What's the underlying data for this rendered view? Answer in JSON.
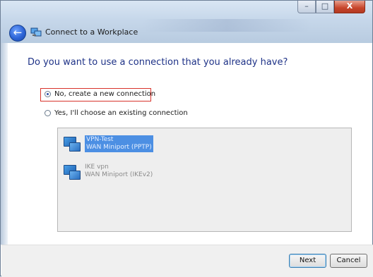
{
  "window": {
    "title": "Connect to a Workplace",
    "controls": {
      "minimize": "–",
      "maximize": "□",
      "close": "X"
    }
  },
  "page": {
    "question": "Do you want to use a connection that you already have?",
    "options": [
      {
        "label": "No, create a new connection",
        "selected": true
      },
      {
        "label": "Yes, I'll choose an existing connection",
        "selected": false
      }
    ]
  },
  "connections": [
    {
      "name": "VPN-Test",
      "device": "WAN Miniport (PPTP)",
      "selected": true
    },
    {
      "name": "IKE vpn",
      "device": "WAN Miniport (IKEv2)",
      "selected": false
    }
  ],
  "footer": {
    "next_label": "Next",
    "cancel_label": "Cancel"
  },
  "colors": {
    "accent": "#2d64d6",
    "heading": "#1e3287",
    "selection": "#4c8fe3",
    "focus_border": "#d8332b"
  },
  "icons": {
    "back": "back-arrow-icon",
    "app": "network-connection-icon",
    "connection": "network-adapter-icon"
  }
}
